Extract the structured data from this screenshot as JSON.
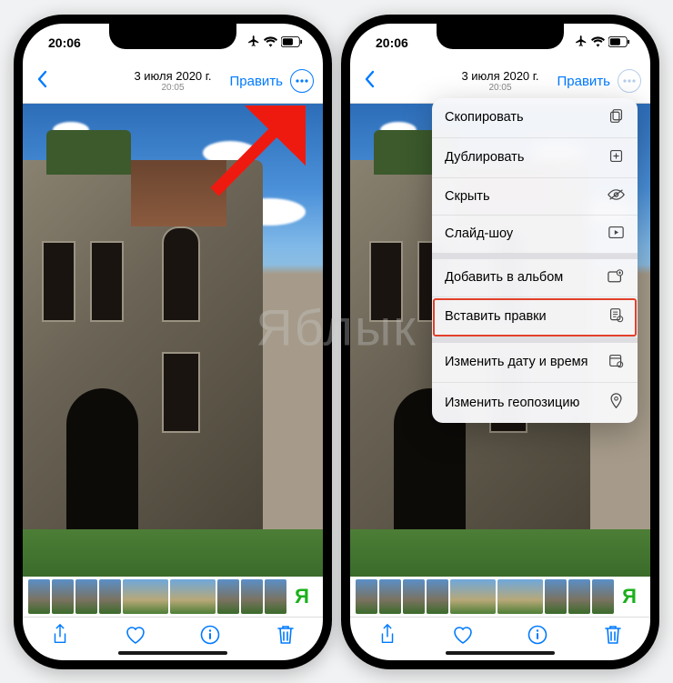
{
  "status": {
    "time": "20:06"
  },
  "nav": {
    "date": "3 июля 2020 г.",
    "time": "20:05",
    "edit": "Править"
  },
  "menu": {
    "copy": "Скопировать",
    "duplicate": "Дублировать",
    "hide": "Скрыть",
    "slideshow": "Слайд-шоу",
    "addToAlbum": "Добавить в альбом",
    "pasteEdits": "Вставить правки",
    "adjustDateTime": "Изменить дату и время",
    "adjustLocation": "Изменить геопозицию"
  },
  "watermark": "Яблык",
  "thumbLogo": "Я"
}
